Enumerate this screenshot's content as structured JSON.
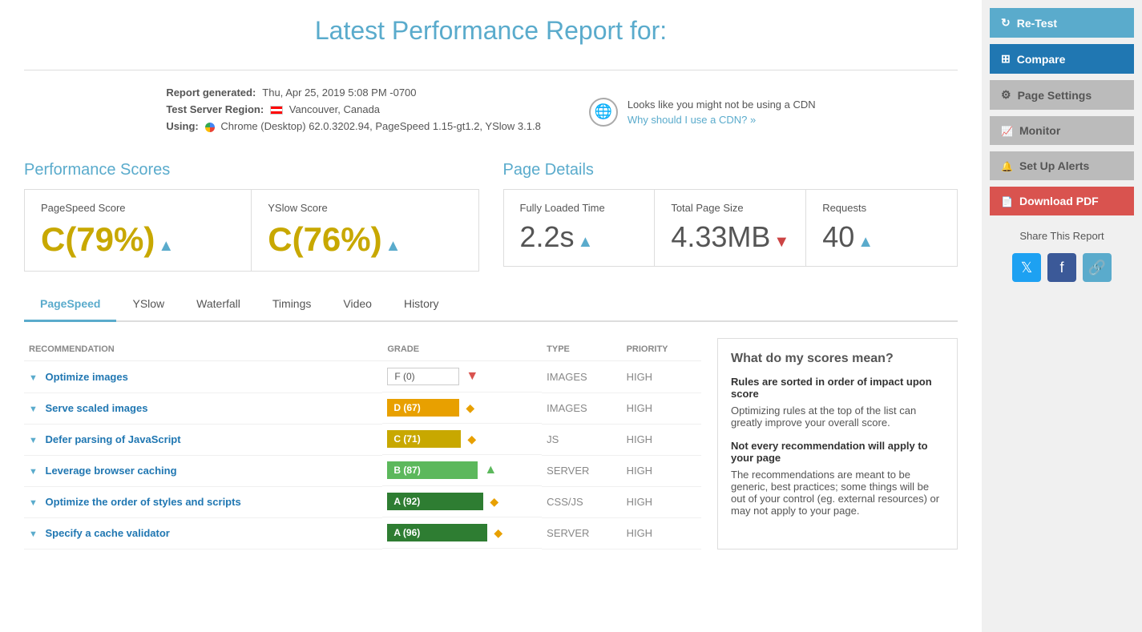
{
  "page": {
    "title": "Latest Performance Report for:"
  },
  "report": {
    "generated_label": "Report generated:",
    "generated_value": "Thu, Apr 25, 2019 5:08 PM -0700",
    "region_label": "Test Server Region:",
    "region_value": "Vancouver, Canada",
    "using_label": "Using:",
    "using_value": "Chrome (Desktop) 62.0.3202.94, PageSpeed 1.15-gt1.2, YSlow 3.1.8",
    "cdn_note": "Looks like you might not be using a CDN",
    "cdn_link": "Why should I use a CDN? »"
  },
  "performance_scores": {
    "title": "Performance Scores",
    "pagespeed": {
      "label": "PageSpeed Score",
      "value": "C(79%)",
      "arrow": "▲"
    },
    "yslow": {
      "label": "YSlow Score",
      "value": "C(76%)",
      "arrow": "▲"
    }
  },
  "page_details": {
    "title": "Page Details",
    "loaded_time": {
      "label": "Fully Loaded Time",
      "value": "2.2s",
      "arrow": "▲"
    },
    "page_size": {
      "label": "Total Page Size",
      "value": "4.33MB",
      "arrow": "▼"
    },
    "requests": {
      "label": "Requests",
      "value": "40",
      "arrow": "▲"
    }
  },
  "tabs": [
    {
      "id": "pagespeed",
      "label": "PageSpeed",
      "active": true
    },
    {
      "id": "yslow",
      "label": "YSlow",
      "active": false
    },
    {
      "id": "waterfall",
      "label": "Waterfall",
      "active": false
    },
    {
      "id": "timings",
      "label": "Timings",
      "active": false
    },
    {
      "id": "video",
      "label": "Video",
      "active": false
    },
    {
      "id": "history",
      "label": "History",
      "active": false
    }
  ],
  "table": {
    "headers": {
      "recommendation": "RECOMMENDATION",
      "grade": "GRADE",
      "type": "TYPE",
      "priority": "PRIORITY"
    },
    "rows": [
      {
        "rec": "Optimize images",
        "grade_text": "F (0)",
        "grade_class": "grade-text",
        "icon": "▼",
        "icon_class": "arrow-down-red",
        "type": "IMAGES",
        "priority": "HIGH"
      },
      {
        "rec": "Serve scaled images",
        "grade_text": "D (67)",
        "grade_class": "grade-d",
        "icon": "◆",
        "icon_class": "diamond-orange",
        "type": "IMAGES",
        "priority": "HIGH"
      },
      {
        "rec": "Defer parsing of JavaScript",
        "grade_text": "C (71)",
        "grade_class": "grade-c-bar",
        "icon": "◆",
        "icon_class": "diamond-orange",
        "type": "JS",
        "priority": "HIGH"
      },
      {
        "rec": "Leverage browser caching",
        "grade_text": "B (87)",
        "grade_class": "grade-b",
        "icon": "▲",
        "icon_class": "arrow-up-green",
        "type": "SERVER",
        "priority": "HIGH"
      },
      {
        "rec": "Optimize the order of styles and scripts",
        "grade_text": "A (92)",
        "grade_class": "grade-a",
        "icon": "◆",
        "icon_class": "diamond-orange",
        "type": "CSS/JS",
        "priority": "HIGH"
      },
      {
        "rec": "Specify a cache validator",
        "grade_text": "A (96)",
        "grade_class": "grade-a",
        "icon": "◆",
        "icon_class": "diamond-orange",
        "type": "SERVER",
        "priority": "HIGH"
      }
    ]
  },
  "scores_panel": {
    "title": "What do my scores mean?",
    "rule_title": "Rules are sorted in order of impact upon score",
    "rule_desc": "Optimizing rules at the top of the list can greatly improve your overall score.",
    "rec_title": "Not every recommendation will apply to your page",
    "rec_desc": "The recommendations are meant to be generic, best practices; some things will be out of your control (eg. external resources) or may not apply to your page."
  },
  "sidebar": {
    "retest_label": "Re-Test",
    "compare_label": "Compare",
    "settings_label": "Page Settings",
    "monitor_label": "Monitor",
    "alerts_label": "Set Up Alerts",
    "pdf_label": "Download PDF",
    "share_title": "Share This Report"
  }
}
